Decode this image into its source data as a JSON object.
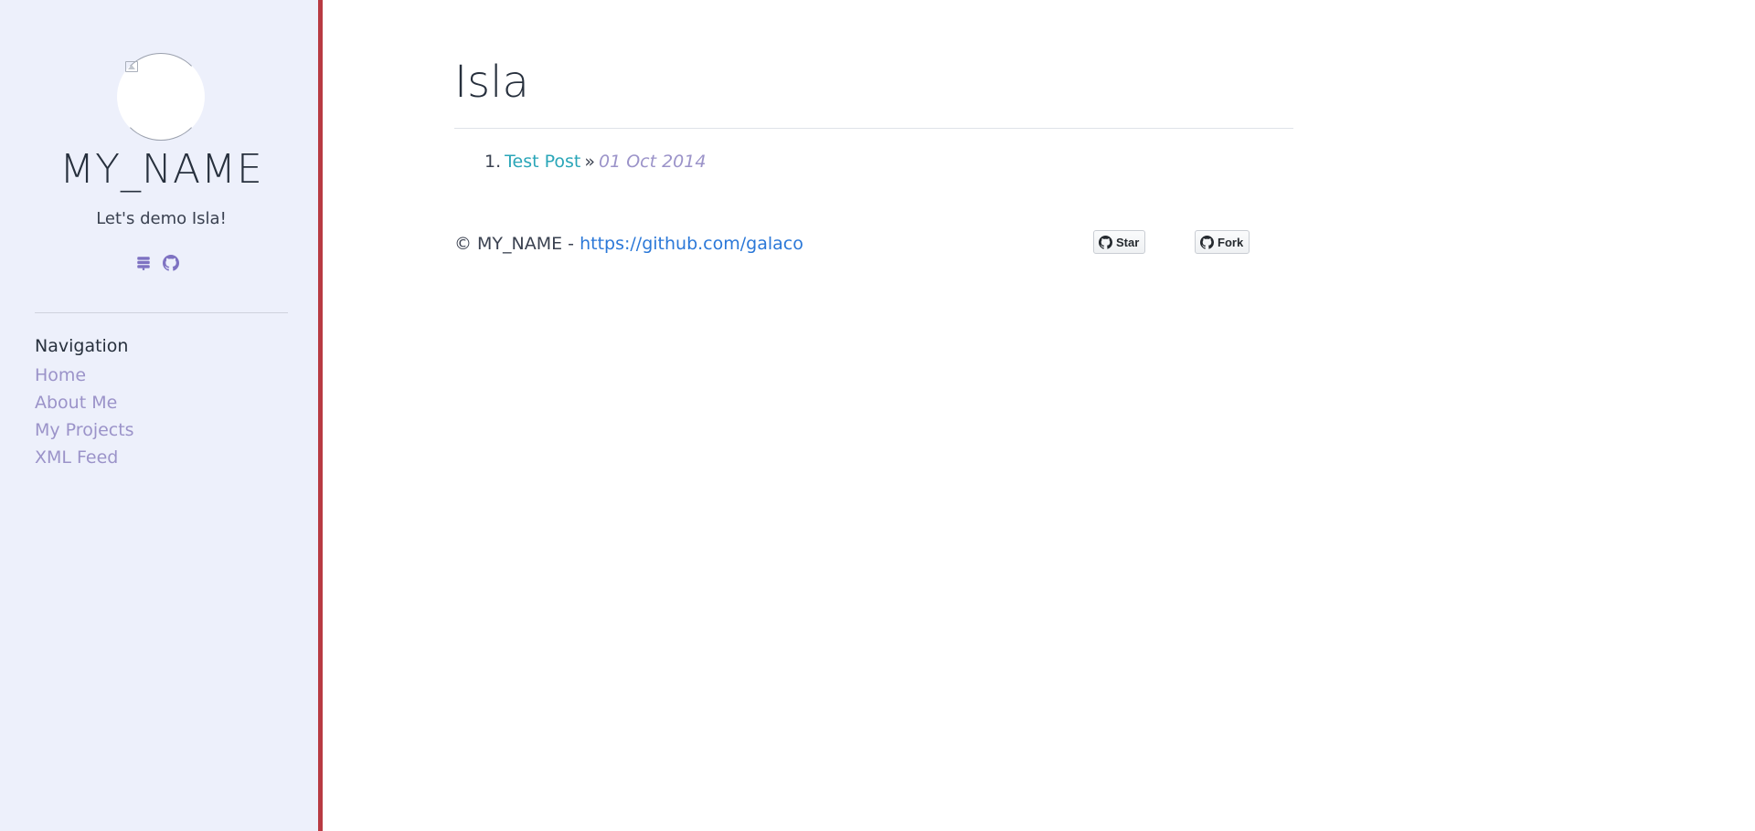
{
  "sidebar": {
    "site_name": "MY_NAME",
    "tagline": "Let's demo Isla!",
    "social_icons": [
      "rss-stack-icon",
      "github-icon"
    ],
    "navigation_title": "Navigation",
    "nav_items": [
      {
        "label": "Home"
      },
      {
        "label": "About Me"
      },
      {
        "label": "My Projects"
      },
      {
        "label": "XML Feed"
      }
    ]
  },
  "main": {
    "title": "Isla",
    "posts": [
      {
        "number": "1.",
        "title": "Test Post",
        "separator": "»",
        "date": "01 Oct 2014"
      }
    ]
  },
  "footer": {
    "copyright": "© MY_NAME - ",
    "link_text": "https://github.com/galaco",
    "star_label": "Star",
    "fork_label": "Fork"
  },
  "colors": {
    "sidebar_bg": "#edf0fb",
    "sidebar_border": "#b83a42",
    "nav_link": "#9b93c9",
    "post_link": "#2aa6b8",
    "footer_link": "#2b78d8"
  }
}
